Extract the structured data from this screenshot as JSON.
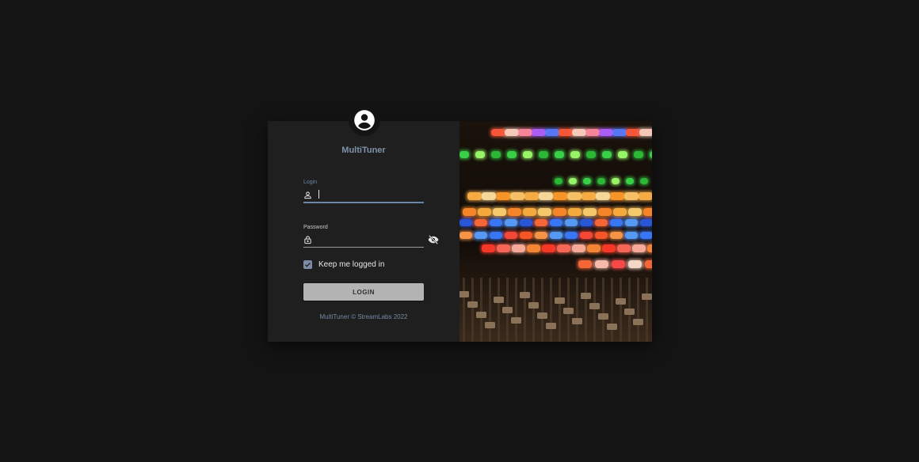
{
  "app": {
    "title": "MultiTuner",
    "avatar_icon": "account-circle-icon"
  },
  "login_field": {
    "label": "Login",
    "value": "",
    "icon": "user-icon"
  },
  "password_field": {
    "label": "Password",
    "value": "",
    "icon": "lock-icon",
    "toggle_icon": "eye-off-icon"
  },
  "remember": {
    "label": "Keep me logged in",
    "checked": true
  },
  "actions": {
    "login_label": "LOGIN"
  },
  "footer": {
    "text": "MultiTuner © StreamLabs 2022"
  },
  "hero_image": {
    "subject": "mixing-console-photo"
  },
  "colors": {
    "background": "#141414",
    "panel": "#1f1f1f",
    "accent": "#6e86a8",
    "button": "#b3b3b3"
  }
}
